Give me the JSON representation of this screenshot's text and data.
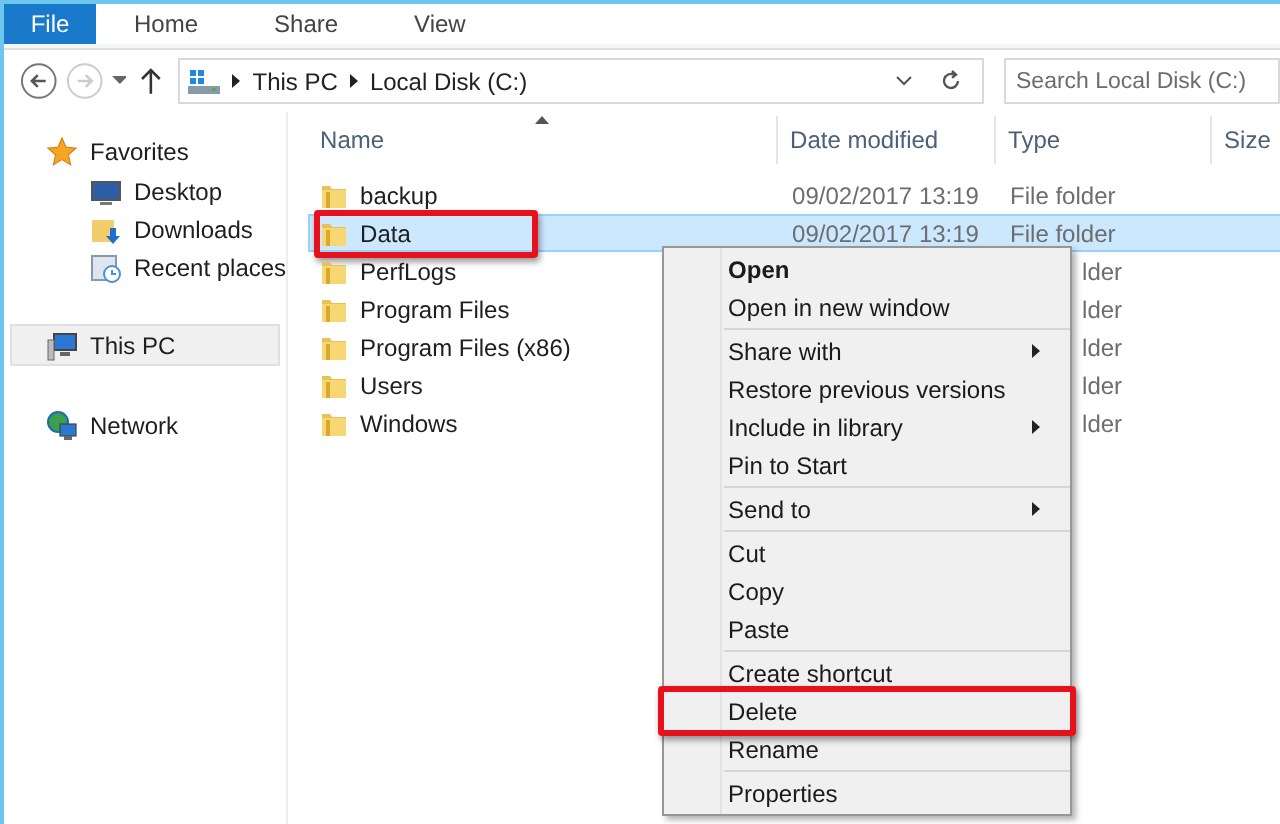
{
  "ribbon": {
    "tabs": [
      {
        "label": "File",
        "kind": "file"
      },
      {
        "label": "Home",
        "kind": "tab"
      },
      {
        "label": "Share",
        "kind": "tab"
      },
      {
        "label": "View",
        "kind": "tab"
      }
    ]
  },
  "address": {
    "path": [
      "This PC",
      "Local Disk (C:)"
    ]
  },
  "search": {
    "placeholder": "Search Local Disk (C:)"
  },
  "nav": [
    {
      "label": "Favorites",
      "kind": "favorites",
      "hovered": false,
      "children": [
        {
          "label": "Desktop",
          "kind": "desktop",
          "hovered": false
        },
        {
          "label": "Downloads",
          "kind": "downloads",
          "hovered": false
        },
        {
          "label": "Recent places",
          "kind": "recent",
          "hovered": false
        }
      ]
    },
    {
      "label": "This PC",
      "kind": "pc",
      "hovered": true
    },
    {
      "label": "Network",
      "kind": "network",
      "hovered": false
    }
  ],
  "columns": [
    {
      "label": "Name",
      "sorted": true
    },
    {
      "label": "Date modified",
      "sorted": false
    },
    {
      "label": "Type",
      "sorted": false
    },
    {
      "label": "Size",
      "sorted": false
    }
  ],
  "files": [
    {
      "name": "backup",
      "date": "09/02/2017 13:19",
      "type": "File folder",
      "selected": false,
      "highlighted": false
    },
    {
      "name": "Data",
      "date": "09/02/2017 13:19",
      "type": "File folder",
      "selected": true,
      "highlighted": true
    },
    {
      "name": "PerfLogs",
      "type": "lder",
      "selected": false,
      "highlighted": false
    },
    {
      "name": "Program Files",
      "type": "lder",
      "selected": false,
      "highlighted": false
    },
    {
      "name": "Program Files (x86)",
      "type": "lder",
      "selected": false,
      "highlighted": false
    },
    {
      "name": "Users",
      "type": "lder",
      "selected": false,
      "highlighted": false
    },
    {
      "name": "Windows",
      "type": "lder",
      "selected": false,
      "highlighted": false
    }
  ],
  "context_menu": {
    "groups": [
      [
        {
          "label": "Open",
          "default": true,
          "submenu": false,
          "highlighted": false
        },
        {
          "label": "Open in new window",
          "default": false,
          "submenu": false,
          "highlighted": false
        }
      ],
      [
        {
          "label": "Share with",
          "default": false,
          "submenu": true,
          "highlighted": false
        },
        {
          "label": "Restore previous versions",
          "default": false,
          "submenu": false,
          "highlighted": false
        },
        {
          "label": "Include in library",
          "default": false,
          "submenu": true,
          "highlighted": false
        },
        {
          "label": "Pin to Start",
          "default": false,
          "submenu": false,
          "highlighted": false
        }
      ],
      [
        {
          "label": "Send to",
          "default": false,
          "submenu": true,
          "highlighted": false
        }
      ],
      [
        {
          "label": "Cut",
          "default": false,
          "submenu": false,
          "highlighted": false
        },
        {
          "label": "Copy",
          "default": false,
          "submenu": false,
          "highlighted": false
        },
        {
          "label": "Paste",
          "default": false,
          "submenu": false,
          "highlighted": false
        }
      ],
      [
        {
          "label": "Create shortcut",
          "default": false,
          "submenu": false,
          "highlighted": false
        },
        {
          "label": "Delete",
          "default": false,
          "submenu": false,
          "highlighted": true
        },
        {
          "label": "Rename",
          "default": false,
          "submenu": false,
          "highlighted": false
        }
      ],
      [
        {
          "label": "Properties",
          "default": false,
          "submenu": false,
          "highlighted": false
        }
      ]
    ]
  }
}
